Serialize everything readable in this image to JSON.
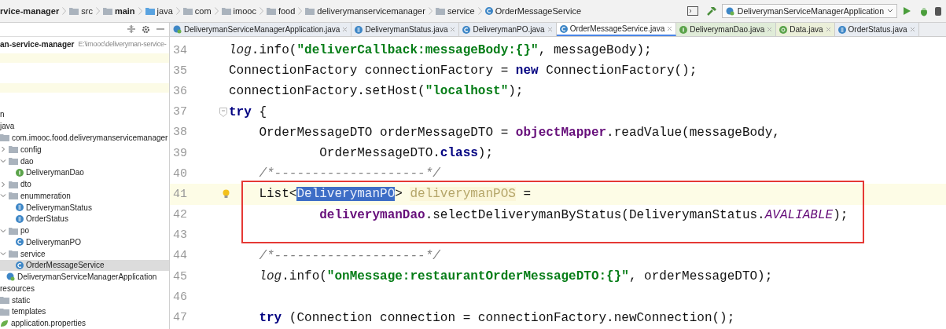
{
  "breadcrumb": [
    {
      "label": "rvice-manager",
      "kind": "project"
    },
    {
      "label": "src",
      "kind": "folder"
    },
    {
      "label": "main",
      "kind": "source"
    },
    {
      "label": "java",
      "kind": "java"
    },
    {
      "label": "com",
      "kind": "folder"
    },
    {
      "label": "imooc",
      "kind": "folder"
    },
    {
      "label": "food",
      "kind": "folder"
    },
    {
      "label": "deliverymanservicemanager",
      "kind": "folder"
    },
    {
      "label": "service",
      "kind": "folder"
    },
    {
      "label": "OrderMessageService",
      "kind": "class"
    }
  ],
  "run_config": {
    "label": "DeliverymanServiceManagerApplication"
  },
  "project": {
    "name": "an-service-manager",
    "path": "E:\\imooc\\deliveryman-service-",
    "tree": [
      {
        "label": "n"
      },
      {
        "label": "java",
        "children": [
          {
            "label": "com.imooc.food.deliverymanservicemanager",
            "kind": "folder",
            "children": [
              {
                "label": "config",
                "kind": "folder",
                "expanded": false,
                "selected": false
              },
              {
                "label": "dao",
                "kind": "folder",
                "expanded": true,
                "selected": false,
                "children": [
                  {
                    "label": "DeliverymanDao",
                    "kind": "interface",
                    "selected": false
                  }
                ]
              },
              {
                "label": "dto",
                "kind": "folder",
                "expanded": false,
                "selected": false
              },
              {
                "label": "enummeration",
                "kind": "folder",
                "expanded": true,
                "selected": false,
                "children": [
                  {
                    "label": "DeliverymanStatus",
                    "kind": "enum",
                    "selected": false
                  },
                  {
                    "label": "OrderStatus",
                    "kind": "enum",
                    "selected": false
                  }
                ]
              },
              {
                "label": "po",
                "kind": "folder",
                "expanded": true,
                "selected": false,
                "children": [
                  {
                    "label": "DeliverymanPO",
                    "kind": "class",
                    "selected": false
                  }
                ]
              },
              {
                "label": "service",
                "kind": "folder",
                "expanded": true,
                "selected": false,
                "children": [
                  {
                    "label": "OrderMessageService",
                    "kind": "class",
                    "selected": true
                  }
                ]
              },
              {
                "label": "DeliverymanServiceManagerApplication",
                "kind": "app",
                "selected": false
              }
            ]
          }
        ]
      },
      {
        "label": "resources",
        "children": [
          {
            "label": "static",
            "kind": "folder"
          },
          {
            "label": "templates",
            "kind": "folder"
          },
          {
            "label": "application.properties",
            "kind": "properties"
          }
        ]
      }
    ]
  },
  "tabs": [
    {
      "label": "DeliverymanServiceManagerApplication.java",
      "kind": "app",
      "selected": false,
      "color": "#e8ecf2"
    },
    {
      "label": "DeliverymanStatus.java",
      "kind": "enum",
      "selected": false,
      "color": "#e8ecf2"
    },
    {
      "label": "DeliverymanPO.java",
      "kind": "class",
      "selected": false,
      "color": "#e8ecf2"
    },
    {
      "label": "OrderMessageService.java",
      "kind": "class",
      "selected": true,
      "color": "#ffffff"
    },
    {
      "label": "DeliverymanDao.java",
      "kind": "interface",
      "selected": false,
      "color": "#e0ecd8"
    },
    {
      "label": "Data.java",
      "kind": "annotation",
      "selected": false,
      "color": "#ebefd9"
    },
    {
      "label": "OrderStatus.java",
      "kind": "enum",
      "selected": false,
      "color": "#e8ecf2"
    }
  ],
  "code": [
    {
      "number": "34",
      "current": false,
      "tokens": [
        {
          "text": "log",
          "kind": "static"
        },
        {
          "text": ".info(",
          "kind": "plain"
        },
        {
          "text": "\"deliverCallback:messageBody:{}\"",
          "kind": "string"
        },
        {
          "text": ", messageBody);",
          "kind": "plain"
        }
      ]
    },
    {
      "number": "35",
      "current": false,
      "tokens": [
        {
          "text": "ConnectionFactory connectionFactory = ",
          "kind": "plain"
        },
        {
          "text": "new",
          "kind": "keyword"
        },
        {
          "text": " ConnectionFactory();",
          "kind": "plain"
        }
      ]
    },
    {
      "number": "36",
      "current": false,
      "tokens": [
        {
          "text": "connectionFactory.setHost(",
          "kind": "plain"
        },
        {
          "text": "\"localhost\"",
          "kind": "string"
        },
        {
          "text": ");",
          "kind": "plain"
        }
      ]
    },
    {
      "number": "37",
      "current": false,
      "fold": true,
      "tokens": [
        {
          "text": "try",
          "kind": "keyword"
        },
        {
          "text": " {",
          "kind": "plain"
        }
      ]
    },
    {
      "number": "38",
      "current": false,
      "tokens": [
        {
          "text": "    OrderMessageDTO orderMessageDTO = ",
          "kind": "plain"
        },
        {
          "text": "objectMapper",
          "kind": "field"
        },
        {
          "text": ".readValue(messageBody,",
          "kind": "plain"
        }
      ]
    },
    {
      "number": "39",
      "current": false,
      "tokens": [
        {
          "text": "            OrderMessageDTO.",
          "kind": "plain"
        },
        {
          "text": "class",
          "kind": "keyword"
        },
        {
          "text": ");",
          "kind": "plain"
        }
      ]
    },
    {
      "number": "40",
      "current": false,
      "tokens": [
        {
          "text": "    /*--------------------*/",
          "kind": "comment"
        }
      ]
    },
    {
      "number": "41",
      "current": true,
      "bulb": true,
      "tokens": [
        {
          "text": "    List<",
          "kind": "plain"
        },
        {
          "text": "DeliverymanPO",
          "kind": "selected"
        },
        {
          "text": "> ",
          "kind": "plain"
        },
        {
          "text": "deliverymanPOS",
          "kind": "unused"
        },
        {
          "text": " =",
          "kind": "plain"
        }
      ]
    },
    {
      "number": "42",
      "current": false,
      "tokens": [
        {
          "text": "            deliverymanDao",
          "kind": "field"
        },
        {
          "text": ".selectDeliverymanByStatus(DeliverymanStatus.",
          "kind": "plain"
        },
        {
          "text": "AVALIABLE",
          "kind": "constant"
        },
        {
          "text": ");",
          "kind": "plain"
        }
      ]
    },
    {
      "number": "43",
      "current": false
    },
    {
      "number": "44",
      "current": false,
      "tokens": [
        {
          "text": "    /*--------------------*/",
          "kind": "comment"
        }
      ]
    },
    {
      "number": "45",
      "current": false,
      "tokens": [
        {
          "text": "    log",
          "kind": "static"
        },
        {
          "text": ".info(",
          "kind": "plain"
        },
        {
          "text": "\"onMessage:restaurantOrderMessageDTO:{}\"",
          "kind": "string"
        },
        {
          "text": ", orderMessageDTO);",
          "kind": "plain"
        }
      ]
    },
    {
      "number": "46",
      "current": false
    },
    {
      "number": "47",
      "current": false,
      "tokens": [
        {
          "text": "    try",
          "kind": "keyword"
        },
        {
          "text": " (Connection connection = connectionFactory.newConnection();",
          "kind": "plain"
        }
      ]
    }
  ]
}
